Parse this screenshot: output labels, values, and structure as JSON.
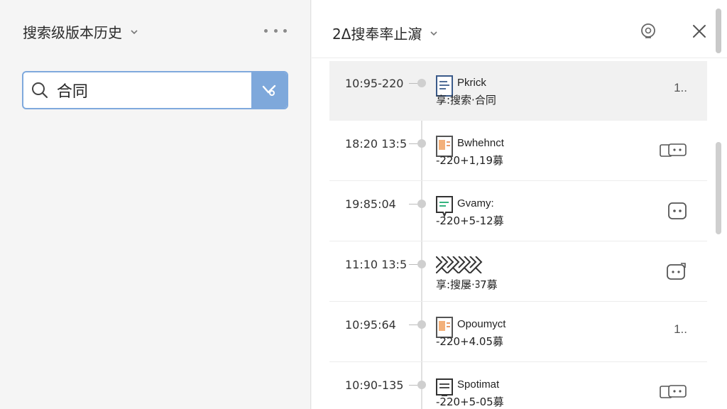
{
  "left": {
    "title": "搜索级版本历史",
    "search": {
      "value": "合同",
      "placeholder": ""
    }
  },
  "right": {
    "title": "2Δ搜奉率止濵",
    "rows": [
      {
        "time": "10:95-220",
        "name": "Pkrick",
        "meta": "享:搜索·合同",
        "action": "1..",
        "action_type": "text",
        "doc_icon": "doc-blue-icon",
        "active": true
      },
      {
        "time": "18:20 13:5",
        "name": "Bwhehnct",
        "meta": "-220+1,19募",
        "action": "",
        "action_type": "chat-icon",
        "doc_icon": "doc-orange-icon",
        "active": false
      },
      {
        "time": "19:85:04",
        "name": "Gvamy:",
        "meta": "-220+5-12募",
        "action": "",
        "action_type": "comment-icon",
        "doc_icon": "doc-green-icon",
        "active": false
      },
      {
        "time": "11:10 13:5",
        "name": "",
        "meta": "享:搜屡·ᢃ7募",
        "action": "",
        "action_type": "share-icon",
        "doc_icon": "doc-pattern-icon",
        "active": false
      },
      {
        "time": "10:95:64",
        "name": "Opoumyct",
        "meta": "-220+4.05募",
        "action": "1..",
        "action_type": "text",
        "doc_icon": "doc-orange-icon",
        "active": false
      },
      {
        "time": "10:90-135",
        "name": "Spotimat",
        "meta": "-220+5-05募",
        "action": "",
        "action_type": "chat-icon",
        "doc_icon": "doc-dark-icon",
        "active": false
      }
    ]
  },
  "colors": {
    "accent": "#7ea8db",
    "accent_border": "#7fa9dd"
  }
}
